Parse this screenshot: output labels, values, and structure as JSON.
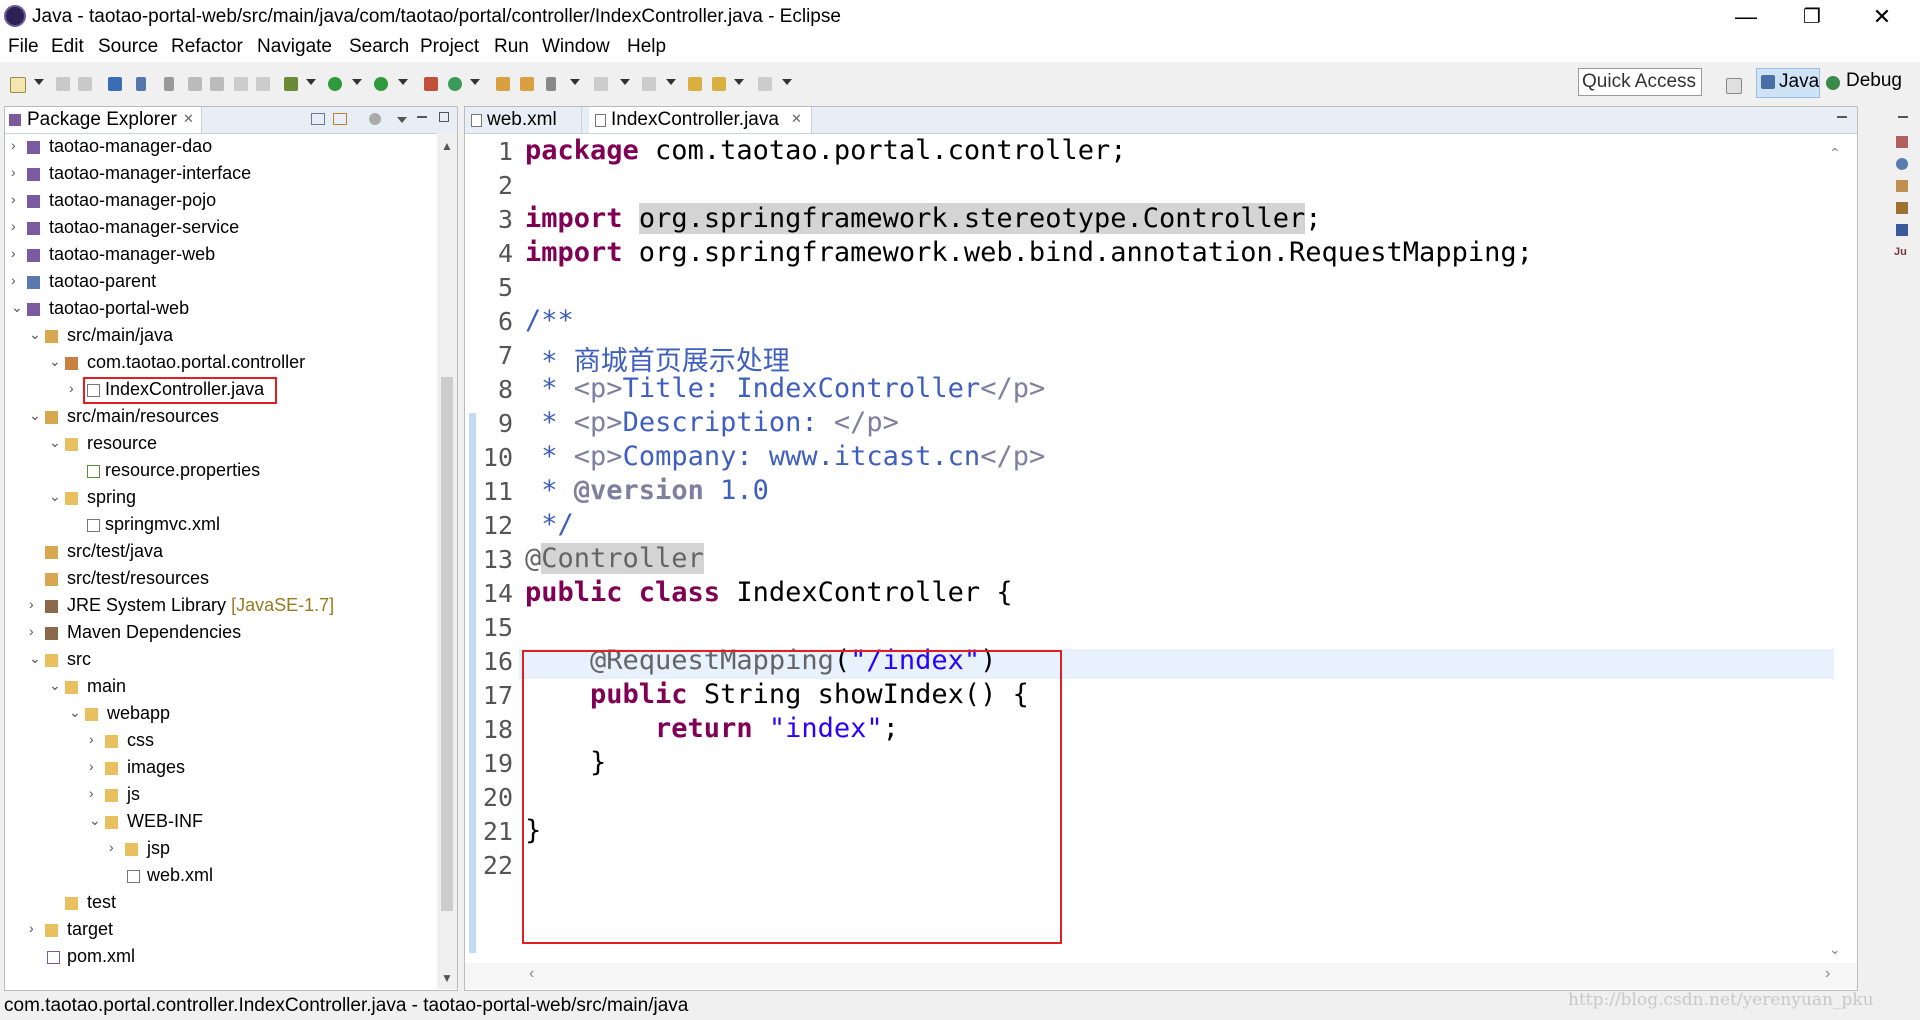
{
  "window": {
    "title": "Java - taotao-portal-web/src/main/java/com/taotao/portal/controller/IndexController.java - Eclipse",
    "minimize": "—",
    "restore": "❐",
    "close": "✕"
  },
  "menu": [
    "File",
    "Edit",
    "Source",
    "Refactor",
    "Navigate",
    "Search",
    "Project",
    "Run",
    "Window",
    "Help"
  ],
  "toolbar": {
    "quick_access": "Quick Access",
    "perspective_java": "Java",
    "perspective_debug": "Debug"
  },
  "package_explorer": {
    "title": "Package Explorer",
    "close": "✕",
    "tree": [
      {
        "label": "taotao-manager-dao",
        "chev": "›",
        "icon": "project"
      },
      {
        "label": "taotao-manager-interface",
        "chev": "›",
        "icon": "project"
      },
      {
        "label": "taotao-manager-pojo",
        "chev": "›",
        "icon": "project"
      },
      {
        "label": "taotao-manager-service",
        "chev": "›",
        "icon": "project"
      },
      {
        "label": "taotao-manager-web",
        "chev": "›",
        "icon": "project"
      },
      {
        "label": "taotao-parent",
        "chev": "›",
        "icon": "project"
      },
      {
        "label": "taotao-portal-web",
        "chev": "⌄",
        "icon": "project"
      },
      {
        "label": "src/main/java",
        "chev": "⌄",
        "icon": "srcfolder"
      },
      {
        "label": "com.taotao.portal.controller",
        "chev": "⌄",
        "icon": "package"
      },
      {
        "label": "IndexController.java",
        "chev": "›",
        "icon": "javafile"
      },
      {
        "label": "src/main/resources",
        "chev": "⌄",
        "icon": "srcfolder"
      },
      {
        "label": "resource",
        "chev": "⌄",
        "icon": "folder"
      },
      {
        "label": "resource.properties",
        "chev": "",
        "icon": "propfile"
      },
      {
        "label": "spring",
        "chev": "⌄",
        "icon": "folder"
      },
      {
        "label": "springmvc.xml",
        "chev": "",
        "icon": "xmlfile"
      },
      {
        "label": "src/test/java",
        "chev": "",
        "icon": "srcfolder"
      },
      {
        "label": "src/test/resources",
        "chev": "",
        "icon": "srcfolder"
      },
      {
        "label": "JRE System Library",
        "decoration": "[JavaSE-1.7]",
        "chev": "›",
        "icon": "library"
      },
      {
        "label": "Maven Dependencies",
        "chev": "›",
        "icon": "library"
      },
      {
        "label": "src",
        "chev": "⌄",
        "icon": "folder"
      },
      {
        "label": "main",
        "chev": "⌄",
        "icon": "folder"
      },
      {
        "label": "webapp",
        "chev": "⌄",
        "icon": "folder"
      },
      {
        "label": "css",
        "chev": "›",
        "icon": "folder"
      },
      {
        "label": "images",
        "chev": "›",
        "icon": "folder"
      },
      {
        "label": "js",
        "chev": "›",
        "icon": "folder"
      },
      {
        "label": "WEB-INF",
        "chev": "⌄",
        "icon": "folder"
      },
      {
        "label": "jsp",
        "chev": "›",
        "icon": "folder"
      },
      {
        "label": "web.xml",
        "chev": "",
        "icon": "xmlfile"
      },
      {
        "label": "test",
        "chev": "",
        "icon": "folder"
      },
      {
        "label": "target",
        "chev": "›",
        "icon": "folder"
      },
      {
        "label": "pom.xml",
        "chev": "",
        "icon": "xmlfile"
      }
    ]
  },
  "editor": {
    "tabs": [
      {
        "label": "web.xml",
        "active": false
      },
      {
        "label": "IndexController.java",
        "active": true,
        "close": "✕"
      }
    ],
    "line_numbers": [
      "1",
      "2",
      "3",
      "4",
      "5",
      "6",
      "7",
      "8",
      "9",
      "10",
      "11",
      "12",
      "13",
      "14",
      "15",
      "16",
      "17",
      "18",
      "19",
      "20",
      "21",
      "22"
    ],
    "code": {
      "l1_kw": "package",
      "l1_rest": " com.taotao.portal.controller;",
      "l3_kw": "import",
      "l3_sp": " ",
      "l3_hl": "org.springframework.stereotype.Controller",
      "l3_end": ";",
      "l4_kw": "import",
      "l4_rest": " org.springframework.web.bind.annotation.RequestMapping;",
      "l6": "/**",
      "l7": " * 商城首页展示处理",
      "l8_a": " * ",
      "l8_t1": "<p>",
      "l8_b": "Title: IndexController",
      "l8_t2": "</p>",
      "l9_a": " * ",
      "l9_t1": "<p>",
      "l9_b": "Description: ",
      "l9_t2": "</p>",
      "l10_a": " * ",
      "l10_t1": "<p>",
      "l10_b": "Company: www.itcast.cn",
      "l10_t2": "</p>",
      "l11_a": " * ",
      "l11_tag": "@version",
      "l11_b": " 1.0",
      "l12": " */",
      "l13_at": "@",
      "l13_hl": "Controller",
      "l14_kw": "public class",
      "l14_rest": " IndexController {",
      "l16_ann": "    @RequestMapping",
      "l16_p1": "(",
      "l16_str": "\"/index\"",
      "l16_p2": ")",
      "l17_kw": "    public",
      "l17_rest": " String showIndex() {",
      "l18_kw": "        return",
      "l18_sp": " ",
      "l18_str": "\"index\"",
      "l18_end": ";",
      "l19": "    }",
      "l21": "}"
    }
  },
  "status": {
    "text": "com.taotao.portal.controller.IndexController.java - taotao-portal-web/src/main/java",
    "watermark": "http://blog.csdn.net/yerenyuan_pku"
  }
}
